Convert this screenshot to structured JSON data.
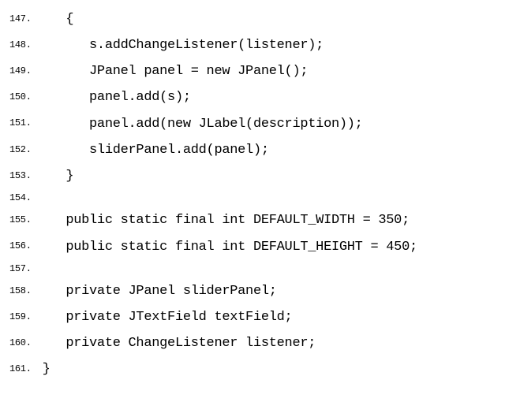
{
  "lines": [
    {
      "n": "147.",
      "t": "   {"
    },
    {
      "n": "148.",
      "t": "      s.addChangeListener(listener);"
    },
    {
      "n": "149.",
      "t": "      JPanel panel = new JPanel();"
    },
    {
      "n": "150.",
      "t": "      panel.add(s);"
    },
    {
      "n": "151.",
      "t": "      panel.add(new JLabel(description));"
    },
    {
      "n": "152.",
      "t": "      sliderPanel.add(panel);"
    },
    {
      "n": "153.",
      "t": "   }"
    },
    {
      "n": "154.",
      "t": ""
    },
    {
      "n": "155.",
      "t": "   public static final int DEFAULT_WIDTH = 350;"
    },
    {
      "n": "156.",
      "t": "   public static final int DEFAULT_HEIGHT = 450;"
    },
    {
      "n": "157.",
      "t": ""
    },
    {
      "n": "158.",
      "t": "   private JPanel sliderPanel;"
    },
    {
      "n": "159.",
      "t": "   private JTextField textField;"
    },
    {
      "n": "160.",
      "t": "   private ChangeListener listener;"
    },
    {
      "n": "161.",
      "t": "}"
    }
  ]
}
